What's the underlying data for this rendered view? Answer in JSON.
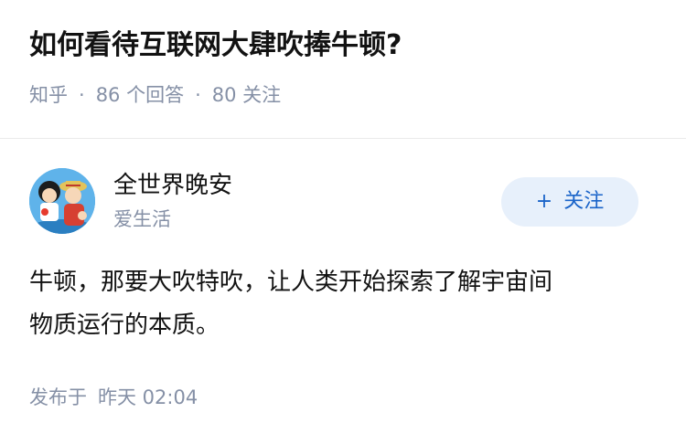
{
  "question": {
    "title": "如何看待互联网大肆吹捧牛顿?",
    "source": "知乎",
    "answer_count": "86 个回答",
    "follower_count": "80 关注"
  },
  "answer": {
    "author_name": "全世界晚安",
    "author_bio": "爱生活",
    "follow_plus": "+",
    "follow_label": "关注",
    "content_line1": "牛顿，那要大吹特吹，让人类开始探索了解宇宙间",
    "content_line2": "物质运行的本质。",
    "published_prefix": "发布于",
    "published_time": "昨天 02:04"
  },
  "colors": {
    "accent": "#1a64c9",
    "follow_bg": "#e7f0fb",
    "meta_text": "#8590a6",
    "title_text": "#121212"
  }
}
